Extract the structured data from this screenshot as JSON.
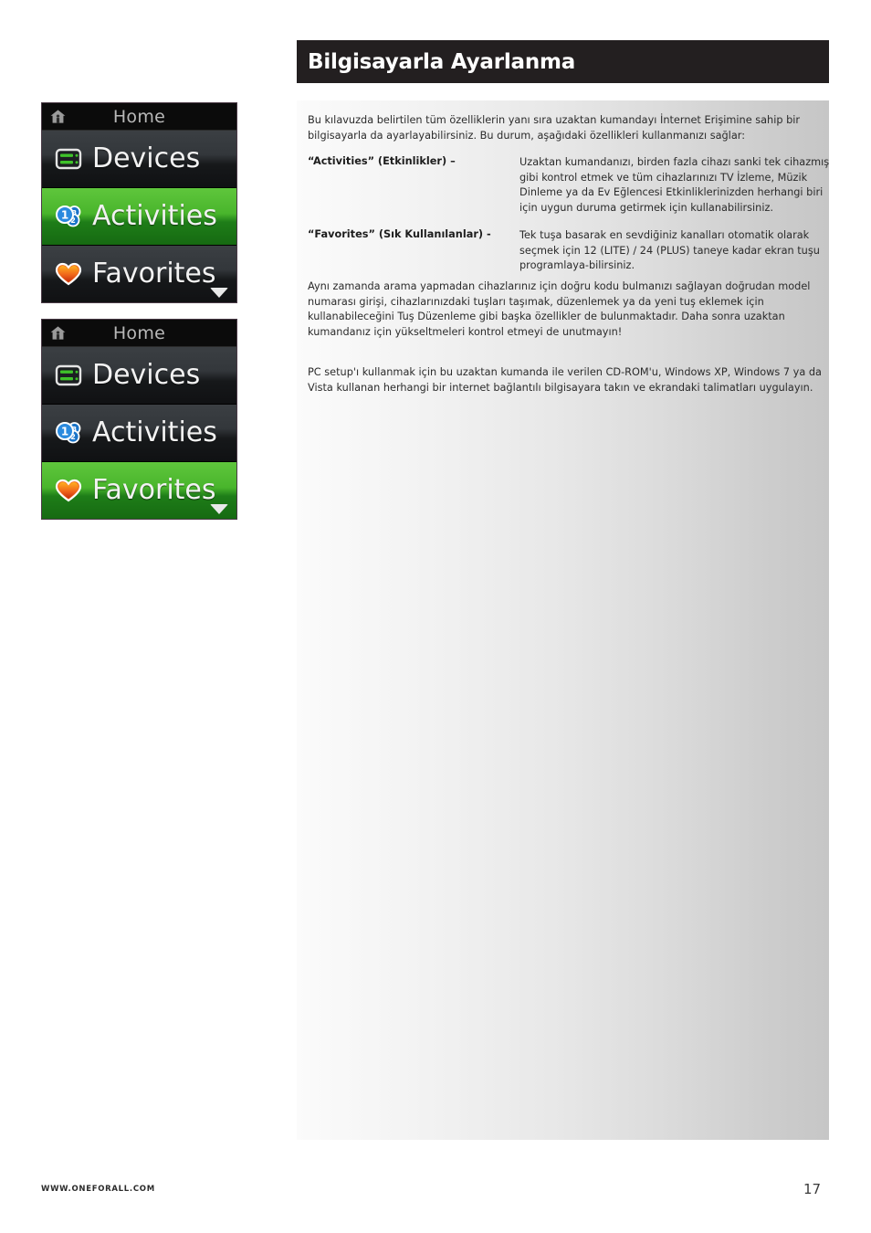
{
  "header": {
    "title": "Bilgisayarla Ayarlanma"
  },
  "content": {
    "intro": "Bu kılavuzda belirtilen tüm özelliklerin yanı sıra uzaktan kumandayı İnternet Erişimine sahip bir bilgisayarla da ayarlayabilirsiniz. Bu durum, aşağıdaki özellikleri kullanmanızı sağlar:",
    "features": [
      {
        "term": "“Activities” (Etkinlikler) –",
        "description": "Uzaktan kumandanızı, birden fazla cihazı sanki tek cihazmış gibi kontrol etmek ve tüm cihazlarınızı TV İzleme, Müzik Dinleme ya da Ev Eğlencesi Etkinliklerinizden herhangi biri için uygun duruma getirmek için kullanabilirsiniz."
      },
      {
        "term": "“Favorites” (Sık Kullanılanlar) -",
        "description": "Tek tuşa basarak en sevdiğiniz kanalları otomatik olarak seçmek için 12 (LITE) / 24 (PLUS) taneye kadar ekran tuşu programlaya-bilirsiniz."
      }
    ],
    "tail_paragraph": "Aynı zamanda arama yapmadan cihazlarınız için doğru kodu bulmanızı sağlayan doğrudan model numarası girişi, cihazlarınızdaki tuşları taşımak, düzenlemek ya da yeni tuş eklemek için kullanabileceğini Tuş Düzenleme gibi başka özellikler de bulunmaktadır. Daha sonra uzaktan kumandanız için yükseltmeleri kontrol etmeyi de unutmayın!",
    "pcsetup_paragraph": "PC setup'ı kullanmak için bu uzaktan kumanda ile verilen CD-ROM'u, Windows XP,  Windows 7 ya da Vista kullanan herhangi bir internet bağlantılı bilgisayara takın ve ekrandaki talimatları uygulayın."
  },
  "mockups": [
    {
      "titlebar": {
        "icon": "home-icon",
        "title": "Home"
      },
      "rows": [
        {
          "icon": "devices-icon",
          "label": "Devices",
          "state": "dark"
        },
        {
          "icon": "activities-icon",
          "label": "Activities",
          "state": "green"
        },
        {
          "icon": "favorites-icon",
          "label": "Favorites",
          "state": "dark"
        }
      ],
      "scroll_indicator": "chevron-down-icon"
    },
    {
      "titlebar": {
        "icon": "home-icon",
        "title": "Home"
      },
      "rows": [
        {
          "icon": "devices-icon",
          "label": "Devices",
          "state": "dark"
        },
        {
          "icon": "activities-icon",
          "label": "Activities",
          "state": "dark"
        },
        {
          "icon": "favorites-icon",
          "label": "Favorites",
          "state": "green"
        }
      ],
      "scroll_indicator": "chevron-down-icon"
    }
  ],
  "footer": {
    "url": "WWW.ONEFORALL.COM",
    "page_number": "17"
  },
  "colors": {
    "header_bar": "#231f20",
    "highlight_green": "#49b52c",
    "menu_dark": "#33373b",
    "device_icon_green": "#3fc22a",
    "activity_icon_blue": "#1a74c8",
    "favorite_icon_orange": "#f06a1e"
  }
}
